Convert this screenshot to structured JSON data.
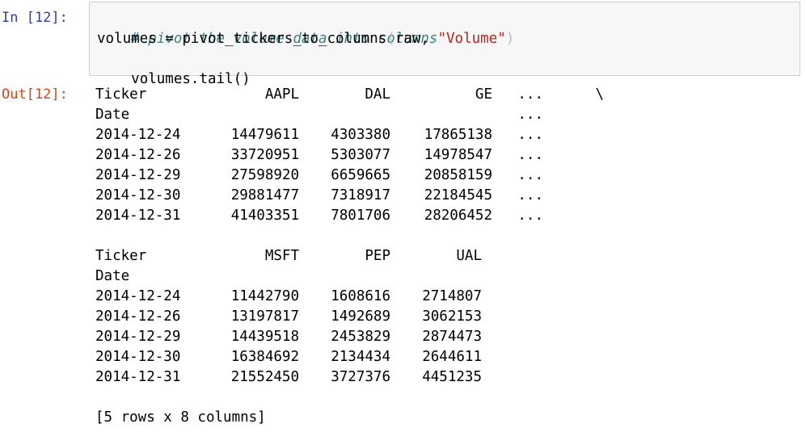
{
  "cell": {
    "in_prompt": "In [12]:",
    "out_prompt": "Out[12]:",
    "code": {
      "comment": "# pivot the volume data into columns",
      "line2_prefix": "volumes = pivot_tickers_to_columns",
      "open_paren": "(",
      "line2_args_a": "raw, ",
      "line2_string": "\"Volume\"",
      "close_paren": ")",
      "line3": "volumes.tail()"
    }
  },
  "output": {
    "block1": {
      "header": {
        "label": "Ticker",
        "cols": [
          "AAPL",
          "DAL",
          "GE"
        ],
        "ellipsis": "...",
        "continuation": "\\"
      },
      "index_label": "Date",
      "index_ellipsis": "...",
      "rows": [
        {
          "date": "2014-12-24",
          "values": [
            "14479611",
            "4303380",
            "17865138"
          ],
          "ellipsis": "..."
        },
        {
          "date": "2014-12-26",
          "values": [
            "33720951",
            "5303077",
            "14978547"
          ],
          "ellipsis": "..."
        },
        {
          "date": "2014-12-29",
          "values": [
            "27598920",
            "6659665",
            "20858159"
          ],
          "ellipsis": "..."
        },
        {
          "date": "2014-12-30",
          "values": [
            "29881477",
            "7318917",
            "22184545"
          ],
          "ellipsis": "..."
        },
        {
          "date": "2014-12-31",
          "values": [
            "41403351",
            "7801706",
            "28206452"
          ],
          "ellipsis": "..."
        }
      ]
    },
    "block2": {
      "header": {
        "label": "Ticker",
        "cols": [
          "MSFT",
          "PEP",
          "UAL"
        ]
      },
      "index_label": "Date",
      "rows": [
        {
          "date": "2014-12-24",
          "values": [
            "11442790",
            "1608616",
            "2714807"
          ]
        },
        {
          "date": "2014-12-26",
          "values": [
            "13197817",
            "1492689",
            "3062153"
          ]
        },
        {
          "date": "2014-12-29",
          "values": [
            "14439518",
            "2453829",
            "2874473"
          ]
        },
        {
          "date": "2014-12-30",
          "values": [
            "16384692",
            "2134434",
            "2644611"
          ]
        },
        {
          "date": "2014-12-31",
          "values": [
            "21552450",
            "3727376",
            "4451235"
          ]
        }
      ]
    },
    "summary": "[5 rows x 8 columns]"
  }
}
